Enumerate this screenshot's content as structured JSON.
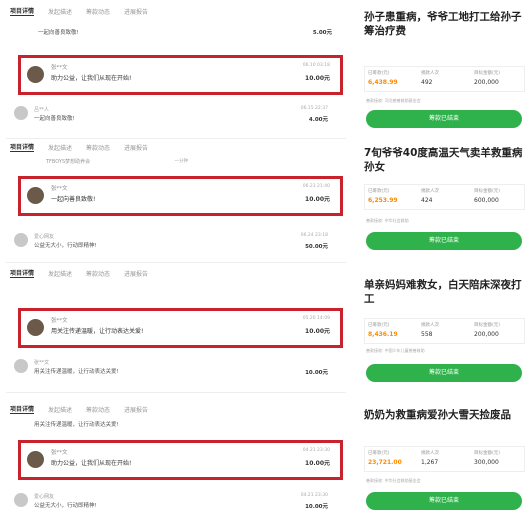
{
  "tabs": [
    "项目详情",
    "发起描述",
    "筹款动态",
    "进展报告"
  ],
  "panels": [
    {
      "top_rows": [
        {
          "name": "",
          "msg": "一起向善良致敬!",
          "time": "",
          "amount": "5.00元"
        }
      ],
      "highlight": {
        "name": "张**文",
        "msg": "助力公益，让我们从现在开始!",
        "time": "06.10 03:18",
        "amount": "10.00元"
      },
      "bottom_rows": [
        {
          "name": "吕**人",
          "msg": "一起向善良致敬!",
          "time": "06.15 22:37",
          "amount": "4.00元"
        }
      ]
    },
    {
      "top_rows": [
        {
          "name": "TFBOYS梦想助养会",
          "msg": "",
          "time": "一分钟",
          "amount": ""
        }
      ],
      "highlight": {
        "name": "张**文",
        "msg": "一起向善良致敬!",
        "time": "06.23 21:40",
        "amount": "10.00元"
      },
      "bottom_rows": [
        {
          "name": "爱心网友",
          "msg": "公益无大小，行动即精神!",
          "time": "06.24 23:18",
          "amount": "50.00元"
        }
      ]
    },
    {
      "top_rows": [],
      "highlight": {
        "name": "张**文",
        "msg": "用关注传递温暖，让行动表达关爱!",
        "time": "05.20 14:09",
        "amount": "10.00元"
      },
      "bottom_rows": [
        {
          "name": "张**文",
          "msg": "用关注传递温暖，让行动表达关爱!",
          "time": "",
          "amount": "10.00元"
        }
      ]
    },
    {
      "top_rows": [
        {
          "name": "",
          "msg": "用关注传递温暖，让行动表达关爱!",
          "time": "",
          "amount": ""
        }
      ],
      "highlight": {
        "name": "张**文",
        "msg": "助力公益，让我们从现在开始!",
        "time": "04.21 23:30",
        "amount": "10.00元"
      },
      "bottom_rows": [
        {
          "name": "爱心网友",
          "msg": "公益无大小，行动即精神!",
          "time": "04.21 23:30",
          "amount": "10.00元"
        }
      ]
    }
  ],
  "cards": [
    {
      "title": "孙子患重病，爷爷工地打工给孙子筹治疗费",
      "stats": [
        {
          "label": "已筹款(元)",
          "value": "6,438.99"
        },
        {
          "label": "捐款人次",
          "value": "492"
        },
        {
          "label": "目标金额(元)",
          "value": "200,000"
        }
      ],
      "meta": "善款接收: 河北慈善救助基金会",
      "button": "筹款已结束"
    },
    {
      "title": "7旬爷爷40度高温天气卖羊救重病孙女",
      "stats": [
        {
          "label": "已筹款(元)",
          "value": "6,253.99"
        },
        {
          "label": "捐款人次",
          "value": "424"
        },
        {
          "label": "目标金额(元)",
          "value": "600,000"
        }
      ],
      "meta": "善款接收: 中华社会救助",
      "button": "筹款已结束"
    },
    {
      "title": "单亲妈妈难救女，白天陪床深夜打工",
      "stats": [
        {
          "label": "已筹款(元)",
          "value": "8,436.19"
        },
        {
          "label": "捐款人次",
          "value": "558"
        },
        {
          "label": "目标金额(元)",
          "value": "200,000"
        }
      ],
      "meta": "善款接收: 中国少年儿童慈善救助",
      "button": "筹款已结束"
    },
    {
      "title": "奶奶为救重病爱孙大雪天捡废品",
      "stats": [
        {
          "label": "已筹款(元)",
          "value": "23,721.00"
        },
        {
          "label": "捐款人次",
          "value": "1,267"
        },
        {
          "label": "目标金额(元)",
          "value": "300,000"
        }
      ],
      "meta": "善款接收: 中华社会救助基金会",
      "button": "筹款已结束"
    }
  ],
  "colors": {
    "highlight_border": "#c8232c",
    "button_green": "#2fb24c",
    "amount_orange": "#ff8a00"
  }
}
